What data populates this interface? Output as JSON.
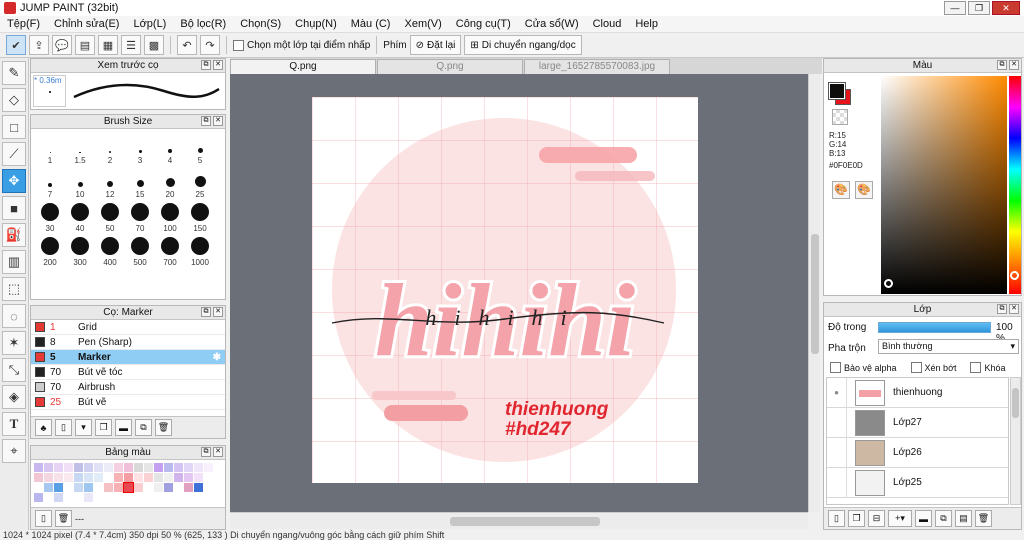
{
  "window": {
    "title": "JUMP PAINT (32bit)"
  },
  "menu": [
    "Tệp(F)",
    "Chỉnh sửa(E)",
    "Lớp(L)",
    "Bộ lọc(R)",
    "Chọn(S)",
    "Chụp(N)",
    "Màu (C)",
    "Xem(V)",
    "Công cụ(T)",
    "Cửa sổ(W)",
    "Cloud",
    "Help"
  ],
  "toolbar": {
    "checkbox_label": "Chọn một lớp tại điểm nhấp",
    "shortcut_label": "Phím",
    "reset_label": "Đặt lại",
    "move_label": "Di chuyển ngang/dọc"
  },
  "brush_preview": {
    "title": "Xem trước cọ",
    "size_label": "* 0.36m"
  },
  "brush_size": {
    "title": "Brush Size",
    "sizes": [
      "1",
      "1.5",
      "2",
      "3",
      "4",
      "5",
      "7",
      "10",
      "12",
      "15",
      "20",
      "25",
      "30",
      "40",
      "50",
      "70",
      "100",
      "150",
      "200",
      "300",
      "400",
      "500",
      "700",
      "1000"
    ]
  },
  "brush_list": {
    "title": "Cọ: Marker",
    "items": [
      {
        "size": "1",
        "name": "Grid",
        "color": "#e53935"
      },
      {
        "size": "8",
        "name": "Pen (Sharp)",
        "color": "#222222"
      },
      {
        "size": "5",
        "name": "Marker",
        "color": "#e53935",
        "selected": true
      },
      {
        "size": "70",
        "name": "Bút vẽ tóc",
        "color": "#222222"
      },
      {
        "size": "70",
        "name": "Airbrush",
        "color": "#cccccc"
      },
      {
        "size": "25",
        "name": "Bút vẽ",
        "color": "#e53935"
      }
    ]
  },
  "palette": {
    "title": "Bảng màu",
    "footer_text": "---"
  },
  "doc_tabs": [
    {
      "label": "Q.png",
      "active": true
    },
    {
      "label": "Q.png",
      "active": false
    },
    {
      "label": "large_1652785570083.jpg",
      "active": false
    }
  ],
  "artwork": {
    "main_word": "hihihi",
    "script_word": "hihihi",
    "credit_line1": "thienhuong",
    "credit_line2": "#hd247"
  },
  "color_panel": {
    "title": "Màu",
    "r": "R:15",
    "g": "G:14",
    "b": "B:13",
    "hex": "#0F0E0D",
    "fg_color": "#0f0e0d",
    "bg_color": "#e8141c"
  },
  "layers": {
    "title": "Lớp",
    "opacity_label": "Độ trong",
    "opacity_value": "100 %",
    "blend_label": "Pha trộn",
    "blend_value": "Bình thường",
    "protect_alpha": "Bảo vệ alpha",
    "clip_label": "Xén bớt",
    "lock_label": "Khóa",
    "items": [
      {
        "name": "thienhuong"
      },
      {
        "name": "Lớp27"
      },
      {
        "name": "Lớp26"
      },
      {
        "name": "Lớp25"
      }
    ]
  },
  "status": "1024 * 1024 pixel   (7.4 * 7.4cm)   350 dpi   50 %   (625, 133 )   Di chuyển ngang/vuông góc bằng cách giữ phím Shift"
}
